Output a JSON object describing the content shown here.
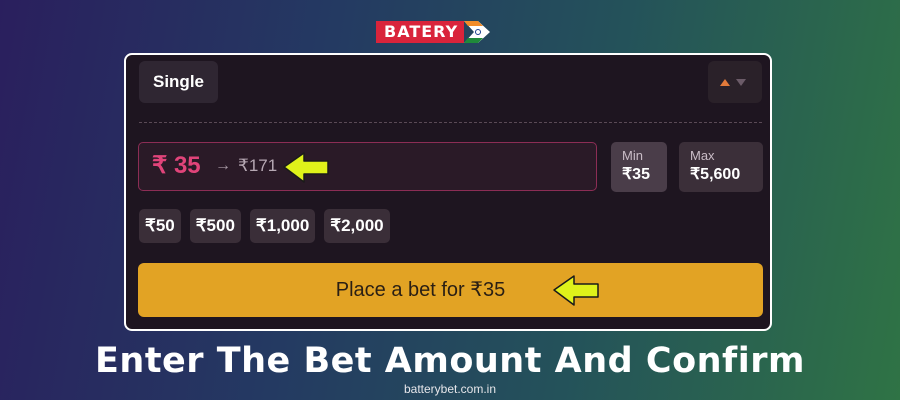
{
  "logo": {
    "text": "BATERY"
  },
  "bet_panel": {
    "mode_tab": "Single",
    "amount": {
      "value": "₹ 35",
      "arrow": "→",
      "payout": "₹171"
    },
    "limits": {
      "min_label": "Min",
      "min_value": "₹35",
      "max_label": "Max",
      "max_value": "₹5,600"
    },
    "quick_amounts": [
      "₹50",
      "₹500",
      "₹1,000",
      "₹2,000"
    ],
    "place_bet_label": "Place a bet for ₹35"
  },
  "headline": "Enter The Bet Amount And Confirm",
  "site": "batterybet.com.in",
  "colors": {
    "accent_pink": "#e0447a",
    "button_yellow": "#e2a324",
    "pointer_arrow": "#dff21a",
    "logo_red": "#d9243b"
  },
  "icons": [
    "sort-arrows-icon",
    "pointer-arrow-icon",
    "india-flag-icon"
  ]
}
